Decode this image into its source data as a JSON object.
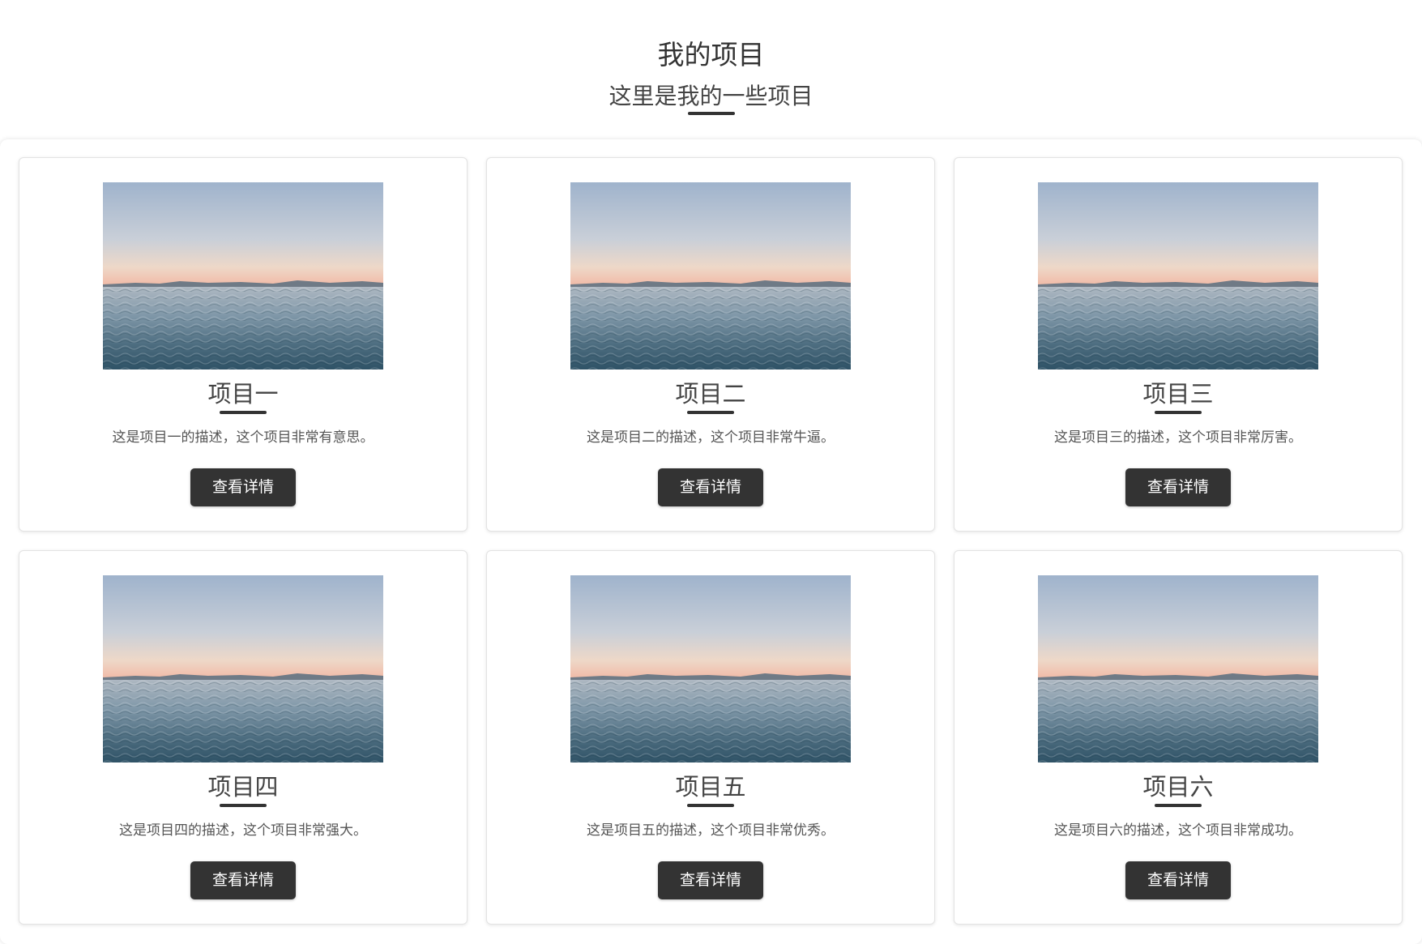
{
  "header": {
    "title": "我的项目",
    "subtitle": "这里是我的一些项目"
  },
  "projects": [
    {
      "title": "项目一",
      "description": "这是项目一的描述，这个项目非常有意思。",
      "button_label": "查看详情",
      "image": "sea-sunset-photo"
    },
    {
      "title": "项目二",
      "description": "这是项目二的描述，这个项目非常牛逼。",
      "button_label": "查看详情",
      "image": "sea-sunset-photo"
    },
    {
      "title": "项目三",
      "description": "这是项目三的描述，这个项目非常厉害。",
      "button_label": "查看详情",
      "image": "sea-sunset-photo"
    },
    {
      "title": "项目四",
      "description": "这是项目四的描述，这个项目非常强大。",
      "button_label": "查看详情",
      "image": "sea-sunset-photo"
    },
    {
      "title": "项目五",
      "description": "这是项目五的描述，这个项目非常优秀。",
      "button_label": "查看详情",
      "image": "sea-sunset-photo"
    },
    {
      "title": "项目六",
      "description": "这是项目六的描述，这个项目非常成功。",
      "button_label": "查看详情",
      "image": "sea-sunset-photo"
    }
  ],
  "colors": {
    "text": "#333333",
    "button_bg": "#333333",
    "button_text": "#ffffff",
    "card_border": "#e3e3e3"
  }
}
